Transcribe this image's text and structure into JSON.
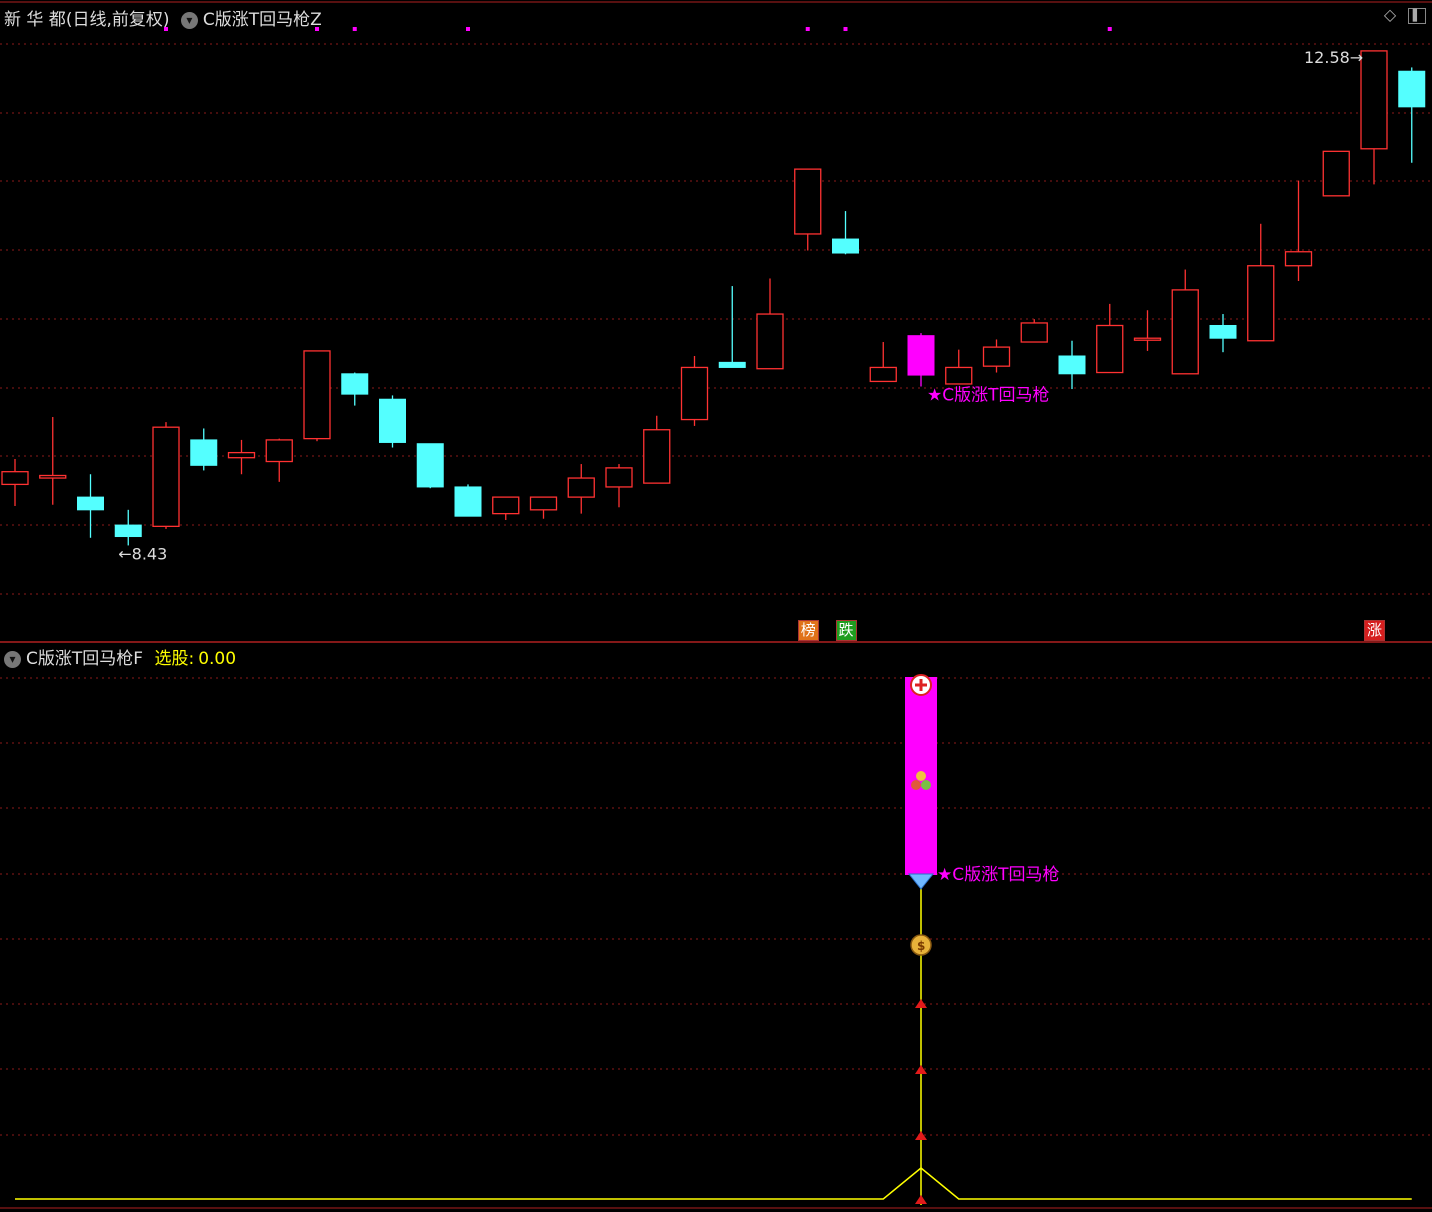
{
  "main_panel": {
    "stock_name": "新 华 都",
    "period_label": "(日线,前复权)",
    "indicator_name": "C版涨T回马枪Z"
  },
  "sub_panel": {
    "indicator_name": "C版涨T回马枪F",
    "select_label": "选股:",
    "select_value": "0.00"
  },
  "colors": {
    "background": "#000000",
    "up_candle": "#ff3232",
    "down_candle": "#54ffff",
    "signal_candle": "#ff00ff",
    "grid": "#8b1a1a",
    "signal_line": "#ffff00"
  },
  "icons": [
    "diamond-icon",
    "window-toggle-icon",
    "chevron-down-icon",
    "plus-circle-icon",
    "coins-icon",
    "diamond-gem-icon",
    "money-bag-icon",
    "red-arrow-up-icon"
  ],
  "chart_data": [
    {
      "type": "candlestick",
      "title": "新 华 都(日线,前复权)",
      "ylim": [
        8.3,
        12.65
      ],
      "grid": true,
      "candles": [
        {
          "open": 9.17,
          "high": 9.37,
          "low": 9.0,
          "close": 9.27
        },
        {
          "open": 9.22,
          "high": 9.7,
          "low": 9.01,
          "close": 9.24
        },
        {
          "open": 9.07,
          "high": 9.25,
          "low": 8.75,
          "close": 8.97
        },
        {
          "open": 8.85,
          "high": 8.97,
          "low": 8.69,
          "close": 8.76
        },
        {
          "open": 8.84,
          "high": 9.66,
          "low": 8.82,
          "close": 9.62
        },
        {
          "open": 9.52,
          "high": 9.61,
          "low": 9.28,
          "close": 9.32
        },
        {
          "open": 9.38,
          "high": 9.52,
          "low": 9.25,
          "close": 9.42
        },
        {
          "open": 9.35,
          "high": 9.53,
          "low": 9.19,
          "close": 9.52
        },
        {
          "open": 9.53,
          "high": 10.22,
          "low": 9.51,
          "close": 10.22
        },
        {
          "open": 10.04,
          "high": 10.05,
          "low": 9.79,
          "close": 9.88
        },
        {
          "open": 9.84,
          "high": 9.87,
          "low": 9.46,
          "close": 9.5
        },
        {
          "open": 9.49,
          "high": 9.49,
          "low": 9.14,
          "close": 9.15
        },
        {
          "open": 9.15,
          "high": 9.17,
          "low": 8.94,
          "close": 8.92
        },
        {
          "open": 8.94,
          "high": 9.07,
          "low": 8.89,
          "close": 9.07
        },
        {
          "open": 8.97,
          "high": 9.07,
          "low": 8.9,
          "close": 9.07
        },
        {
          "open": 9.07,
          "high": 9.33,
          "low": 8.94,
          "close": 9.22
        },
        {
          "open": 9.15,
          "high": 9.33,
          "low": 8.99,
          "close": 9.3
        },
        {
          "open": 9.18,
          "high": 9.71,
          "low": 9.18,
          "close": 9.6
        },
        {
          "open": 9.68,
          "high": 10.18,
          "low": 9.63,
          "close": 10.09
        },
        {
          "open": 10.13,
          "high": 10.73,
          "low": 10.13,
          "close": 10.09
        },
        {
          "open": 10.08,
          "high": 10.79,
          "low": 10.08,
          "close": 10.51
        },
        {
          "open": 11.14,
          "high": 11.57,
          "low": 11.01,
          "close": 11.65
        },
        {
          "open": 11.1,
          "high": 11.32,
          "low": 10.98,
          "close": 10.99
        },
        {
          "open": 9.98,
          "high": 10.29,
          "low": 9.98,
          "close": 10.09
        },
        {
          "open": 10.03,
          "high": 10.36,
          "low": 9.94,
          "close": 10.34
        },
        {
          "open": 9.96,
          "high": 10.23,
          "low": 9.96,
          "close": 10.09
        },
        {
          "open": 10.1,
          "high": 10.31,
          "low": 10.05,
          "close": 10.25
        },
        {
          "open": 10.29,
          "high": 10.47,
          "low": 10.31,
          "close": 10.44
        },
        {
          "open": 10.18,
          "high": 10.3,
          "low": 9.92,
          "close": 10.04
        },
        {
          "open": 10.05,
          "high": 10.59,
          "low": 10.06,
          "close": 10.42
        },
        {
          "open": 10.32,
          "high": 10.54,
          "low": 10.22,
          "close": 10.32
        },
        {
          "open": 10.04,
          "high": 10.86,
          "low": 10.04,
          "close": 10.7
        },
        {
          "open": 10.42,
          "high": 10.51,
          "low": 10.21,
          "close": 10.32
        },
        {
          "open": 10.3,
          "high": 11.22,
          "low": 10.3,
          "close": 10.89
        },
        {
          "open": 10.89,
          "high": 11.56,
          "low": 10.77,
          "close": 11.0
        },
        {
          "open": 11.44,
          "high": 11.54,
          "low": 11.5,
          "close": 11.79
        },
        {
          "open": 11.81,
          "high": 12.58,
          "low": 11.53,
          "close": 12.58
        },
        {
          "open": 12.42,
          "high": 12.45,
          "low": 11.7,
          "close": 12.14
        }
      ],
      "signal_candle_index": 24,
      "candle_annotation": "★C版涨T回马枪",
      "price_labels": [
        {
          "text": "8.43",
          "candle_index": 3
        },
        {
          "text": "12.58",
          "candle_index": 36
        }
      ],
      "top_markers": [
        4,
        8,
        9,
        12,
        21,
        22,
        29
      ],
      "event_badges": [
        {
          "text": "榜",
          "candle_index": 21,
          "color": "#e0721a"
        },
        {
          "text": "跌",
          "candle_index": 22,
          "color": "#1f9d1f"
        },
        {
          "text": "涨",
          "candle_index": 36,
          "color": "#d61e1e"
        }
      ]
    },
    {
      "type": "line",
      "title": "C版涨T回马枪F",
      "grid": true,
      "series": [
        {
          "name": "选股",
          "values": [
            0,
            0,
            0,
            0,
            0,
            0,
            0,
            0,
            0,
            0,
            0,
            0,
            0,
            0,
            0,
            0,
            0,
            0,
            0,
            0,
            0,
            0,
            0,
            0,
            0.5,
            0,
            0,
            0,
            0,
            0,
            0,
            0,
            0,
            0,
            0,
            0,
            0,
            0
          ]
        }
      ],
      "signal_bar_index": 24,
      "bar_annotation": "★C版涨T回马枪"
    }
  ]
}
